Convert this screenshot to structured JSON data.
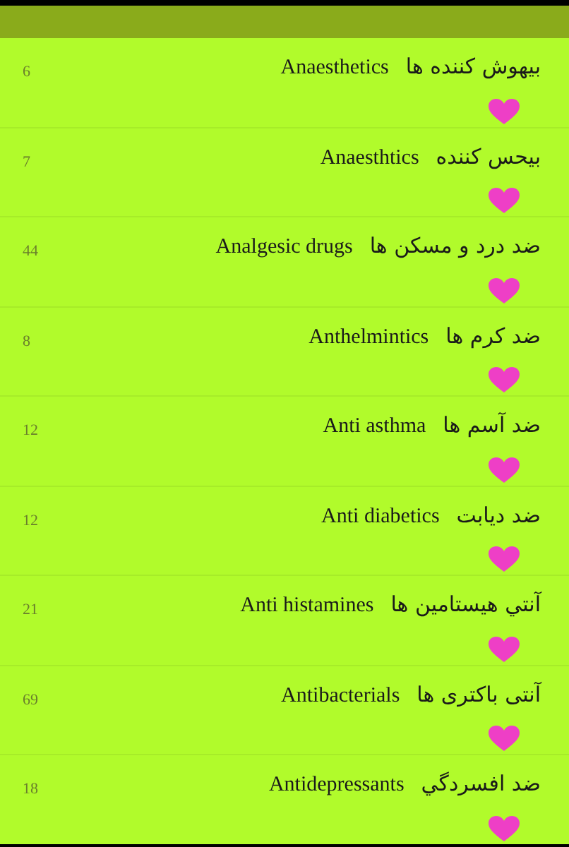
{
  "items": [
    {
      "count": "6",
      "persian": "بیهوش کننده ها",
      "english": "Anaesthetics"
    },
    {
      "count": "7",
      "persian": "بیحس کننده",
      "english": "Anaesthtics"
    },
    {
      "count": "44",
      "persian": "ضد درد و مسکن ها",
      "english": "Analgesic drugs"
    },
    {
      "count": "8",
      "persian": "ضد کرم ها",
      "english": "Anthelmintics"
    },
    {
      "count": "12",
      "persian": "ضد آسم ها",
      "english": "Anti asthma"
    },
    {
      "count": "12",
      "persian": "ضد دیابت",
      "english": "Anti diabetics"
    },
    {
      "count": "21",
      "persian": "آنتي هيستامين ها",
      "english": "Anti histamines"
    },
    {
      "count": "69",
      "persian": "آنتی باکتری ها",
      "english": "Antibacterials"
    },
    {
      "count": "18",
      "persian": "ضد افسردگي",
      "english": "Antidepressants"
    }
  ]
}
